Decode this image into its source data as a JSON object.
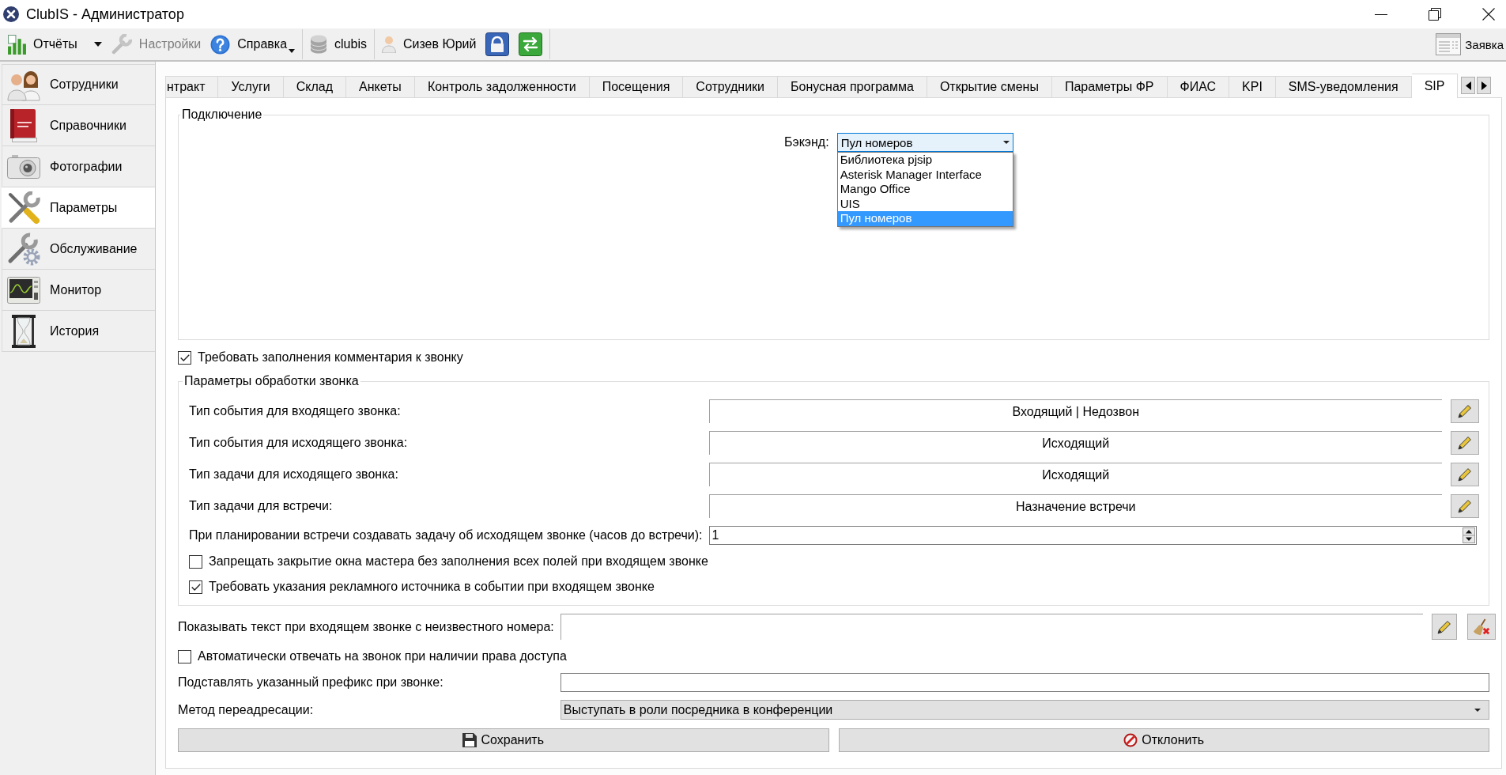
{
  "window": {
    "title": "ClubIS - Администратор"
  },
  "toolbar": {
    "groups": [
      {
        "items": [
          {
            "kind": "reports",
            "label": "Отчёты",
            "disabled": false,
            "dropdown": true
          },
          {
            "kind": "settings",
            "label": "Настройки",
            "disabled": true,
            "dropdown": false
          },
          {
            "kind": "help",
            "label": "Справка",
            "disabled": false,
            "dropdown": true
          }
        ]
      },
      {
        "items": [
          {
            "kind": "database",
            "label": "clubis",
            "disabled": false,
            "dropdown": false
          }
        ]
      },
      {
        "items": [
          {
            "kind": "user",
            "label": "Сизев Юрий",
            "disabled": false,
            "dropdown": false
          },
          {
            "kind": "lock",
            "disabled": false,
            "dropdown": false
          },
          {
            "kind": "exit",
            "disabled": false,
            "dropdown": false
          }
        ]
      }
    ],
    "request": {
      "label": "Заявка"
    }
  },
  "sidebar": {
    "items": [
      {
        "kind": "staff",
        "label": "Сотрудники",
        "selected": false
      },
      {
        "kind": "directories",
        "label": "Справочники",
        "selected": false
      },
      {
        "kind": "photos",
        "label": "Фотографии",
        "selected": false
      },
      {
        "kind": "parameters",
        "label": "Параметры",
        "selected": true
      },
      {
        "kind": "maintenance",
        "label": "Обслуживание",
        "selected": false
      },
      {
        "kind": "monitor",
        "label": "Монитор",
        "selected": false
      },
      {
        "kind": "history",
        "label": "История",
        "selected": false
      }
    ]
  },
  "tabs": [
    {
      "label": "нтракт",
      "selected": false
    },
    {
      "label": "Услуги",
      "selected": false
    },
    {
      "label": "Склад",
      "selected": false
    },
    {
      "label": "Анкеты",
      "selected": false
    },
    {
      "label": "Контроль задолженности",
      "selected": false
    },
    {
      "label": "Посещения",
      "selected": false
    },
    {
      "label": "Сотрудники",
      "selected": false
    },
    {
      "label": "Бонусная программа",
      "selected": false
    },
    {
      "label": "Открытие смены",
      "selected": false
    },
    {
      "label": "Параметры ФР",
      "selected": false
    },
    {
      "label": "ФИАС",
      "selected": false
    },
    {
      "label": "KPI",
      "selected": false
    },
    {
      "label": "SMS-уведомления",
      "selected": false
    },
    {
      "label": "SIP",
      "selected": true
    }
  ],
  "sip": {
    "connection": {
      "title": "Подключение",
      "backend": {
        "label": "Бэкэнд:",
        "value": "Пул номеров",
        "expanded": true,
        "options": [
          {
            "label": "Библиотека pjsip",
            "selected": false
          },
          {
            "label": "Asterisk Manager Interface",
            "selected": false
          },
          {
            "label": "Mango Office",
            "selected": false
          },
          {
            "label": "UIS",
            "selected": false
          },
          {
            "label": "Пул номеров",
            "selected": true
          }
        ]
      }
    },
    "require_comment": {
      "label": "Требовать заполнения комментария к звонку",
      "checked": true
    },
    "call_processing": {
      "title": "Параметры обработки звонка",
      "types": [
        {
          "label": "Тип события для входящего звонка:",
          "value": "Входящий | Недозвон"
        },
        {
          "label": "Тип события для исходящего звонка:",
          "value": "Исходящий"
        },
        {
          "label": "Тип задачи для исходящего звонка:",
          "value": "Исходящий"
        },
        {
          "label": "Тип задачи для встречи:",
          "value": "Назначение встречи"
        }
      ],
      "hours_before_meeting": {
        "label": "При планировании встречи создавать задачу об исходящем звонке (часов до встречи):",
        "value": "1"
      },
      "options": [
        {
          "label": "Запрещать закрытие окна мастера без заполнения всех полей при входящем звонке",
          "checked": false
        },
        {
          "label": "Требовать указания рекламного источника в событии при входящем звонке",
          "checked": true
        }
      ]
    },
    "unknown_number_text": {
      "label": "Показывать текст при входящем звонке с неизвестного номера:"
    },
    "auto_answer": {
      "label": "Автоматически отвечать на звонок при наличии права доступа",
      "checked": false
    },
    "prefix": {
      "label": "Подставлять указанный префикс при звонке:"
    },
    "transfer_method": {
      "label": "Метод переадресации:",
      "value": "Выступать в роли посредника в конференции"
    }
  },
  "buttons": [
    {
      "kind": "save",
      "label": "Сохранить"
    },
    {
      "kind": "cancel",
      "label": "Отклонить"
    }
  ]
}
